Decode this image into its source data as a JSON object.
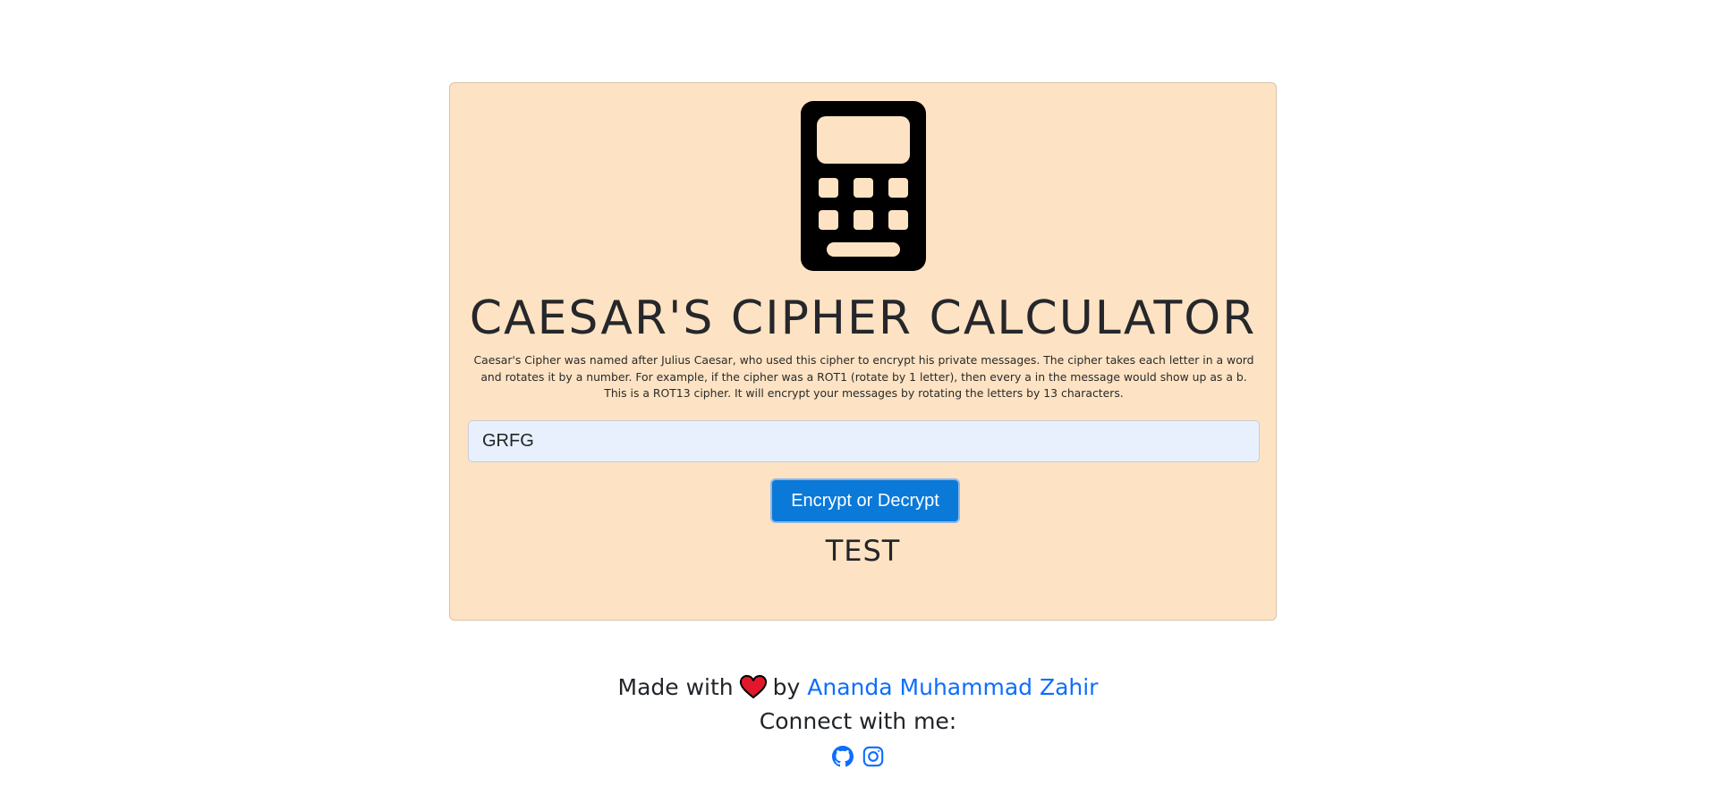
{
  "app": {
    "icon": "calculator-icon",
    "title": "CAESAR'S CIPHER CALCULATOR",
    "description": "Caesar's Cipher was named after Julius Caesar, who used this cipher to encrypt his private messages. The cipher takes each letter in a word and rotates it by a number. For example, if the cipher was a ROT1 (rotate by 1 letter), then every a in the message would show up as a b. This is a ROT13 cipher. It will encrypt your messages by rotating the letters by 13 characters.",
    "input_value": "GRFG",
    "button_label": "Encrypt or Decrypt",
    "result": "TEST"
  },
  "footer": {
    "made_with": "Made with",
    "by": "by",
    "heart_icon": "heart-icon",
    "author": "Ananda Muhammad Zahir",
    "connect": "Connect with me:",
    "social_icons": [
      "github-icon",
      "instagram-icon"
    ]
  },
  "colors": {
    "card_background": "#fde3c3",
    "button": "#0b79d8",
    "link": "#0d6efd",
    "input_background": "#e8f0fe"
  }
}
